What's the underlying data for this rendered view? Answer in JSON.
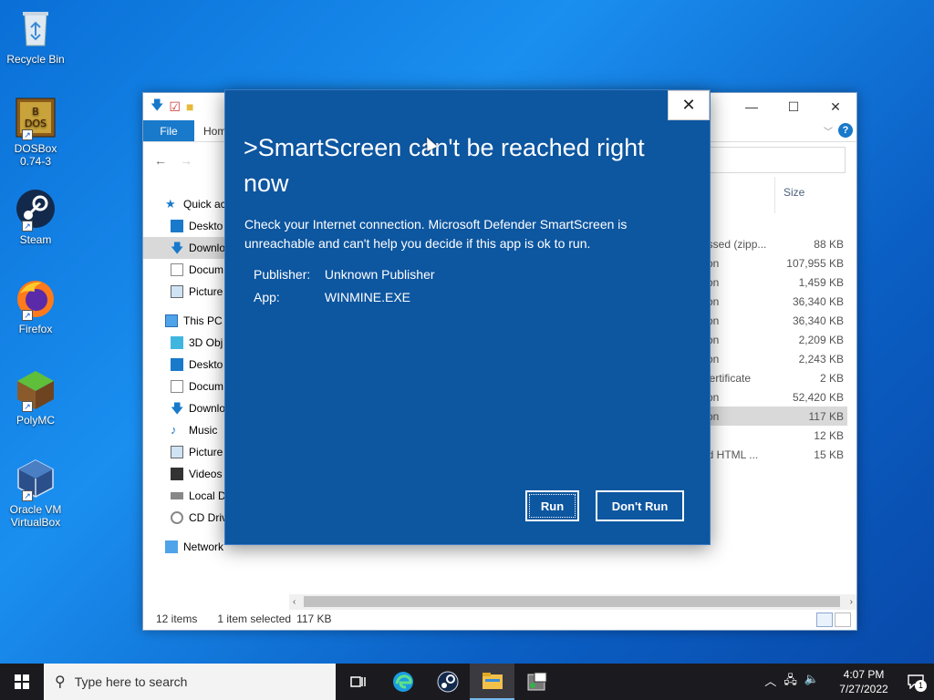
{
  "desktop": {
    "icons": [
      {
        "label": "Recycle Bin",
        "icon": "recycle-bin-icon"
      },
      {
        "label": "DOSBox 0.74-3",
        "icon": "dosbox-icon"
      },
      {
        "label": "Steam",
        "icon": "steam-icon"
      },
      {
        "label": "Firefox",
        "icon": "firefox-icon"
      },
      {
        "label": "PolyMC",
        "icon": "polymc-icon"
      },
      {
        "label": "Oracle VM VirtualBox",
        "icon": "virtualbox-icon"
      }
    ]
  },
  "explorer": {
    "ribbon": {
      "file_tab": "File",
      "home_tab": "Hom"
    },
    "column_size": "Size",
    "sidebar": [
      {
        "label": "Quick ac",
        "icon": "star-icon",
        "top": true
      },
      {
        "label": "Deskto",
        "icon": "desktop-icon"
      },
      {
        "label": "Downlo",
        "icon": "download-icon",
        "selected": true
      },
      {
        "label": "Docum",
        "icon": "documents-icon"
      },
      {
        "label": "Picture",
        "icon": "pictures-icon"
      },
      {
        "label": "This PC",
        "icon": "computer-icon",
        "top": true
      },
      {
        "label": "3D Obj",
        "icon": "cube-icon"
      },
      {
        "label": "Deskto",
        "icon": "desktop-icon"
      },
      {
        "label": "Docum",
        "icon": "documents-icon"
      },
      {
        "label": "Downlo",
        "icon": "download-icon"
      },
      {
        "label": "Music",
        "icon": "music-icon"
      },
      {
        "label": "Picture",
        "icon": "pictures-icon"
      },
      {
        "label": "Videos",
        "icon": "videos-icon"
      },
      {
        "label": "Local D",
        "icon": "drive-icon"
      },
      {
        "label": "CD Driv",
        "icon": "cd-icon"
      },
      {
        "label": "Network",
        "icon": "network-icon",
        "top": true
      }
    ],
    "rows": [
      {
        "type": "essed (zipp...",
        "size": "88 KB"
      },
      {
        "type": "tion",
        "size": "107,955 KB"
      },
      {
        "type": "tion",
        "size": "1,459 KB"
      },
      {
        "type": "tion",
        "size": "36,340 KB"
      },
      {
        "type": "tion",
        "size": "36,340 KB"
      },
      {
        "type": "tion",
        "size": "2,209 KB"
      },
      {
        "type": "tion",
        "size": "2,243 KB"
      },
      {
        "type": "Certificate",
        "size": "2 KB"
      },
      {
        "type": "tion",
        "size": "52,420 KB"
      },
      {
        "type": "tion",
        "size": "117 KB",
        "selected": true
      },
      {
        "type": "e",
        "size": "12 KB"
      },
      {
        "type": "ed HTML ...",
        "size": "15 KB"
      }
    ],
    "status": {
      "items": "12 items",
      "selected": "1 item selected",
      "size": "117 KB"
    }
  },
  "dialog": {
    "title": ">SmartScreen can't be reached right now",
    "message": "Check your Internet connection. Microsoft Defender SmartScreen is unreachable and can't help you decide if this app is ok to run.",
    "publisher_label": "Publisher:",
    "publisher_value": "Unknown Publisher",
    "app_label": "App:",
    "app_value": "WINMINE.EXE",
    "run_button": "Run",
    "dont_run_button": "Don't Run",
    "close_glyph": "✕",
    "background_color": "#0d56a0"
  },
  "taskbar": {
    "search_placeholder": "Type here to search",
    "apps": [
      "task-view-icon",
      "edge-icon",
      "steam-icon",
      "file-explorer-icon",
      "app-window-icon"
    ],
    "clock_time": "4:07 PM",
    "clock_date": "7/27/2022",
    "notification_count": "1"
  }
}
